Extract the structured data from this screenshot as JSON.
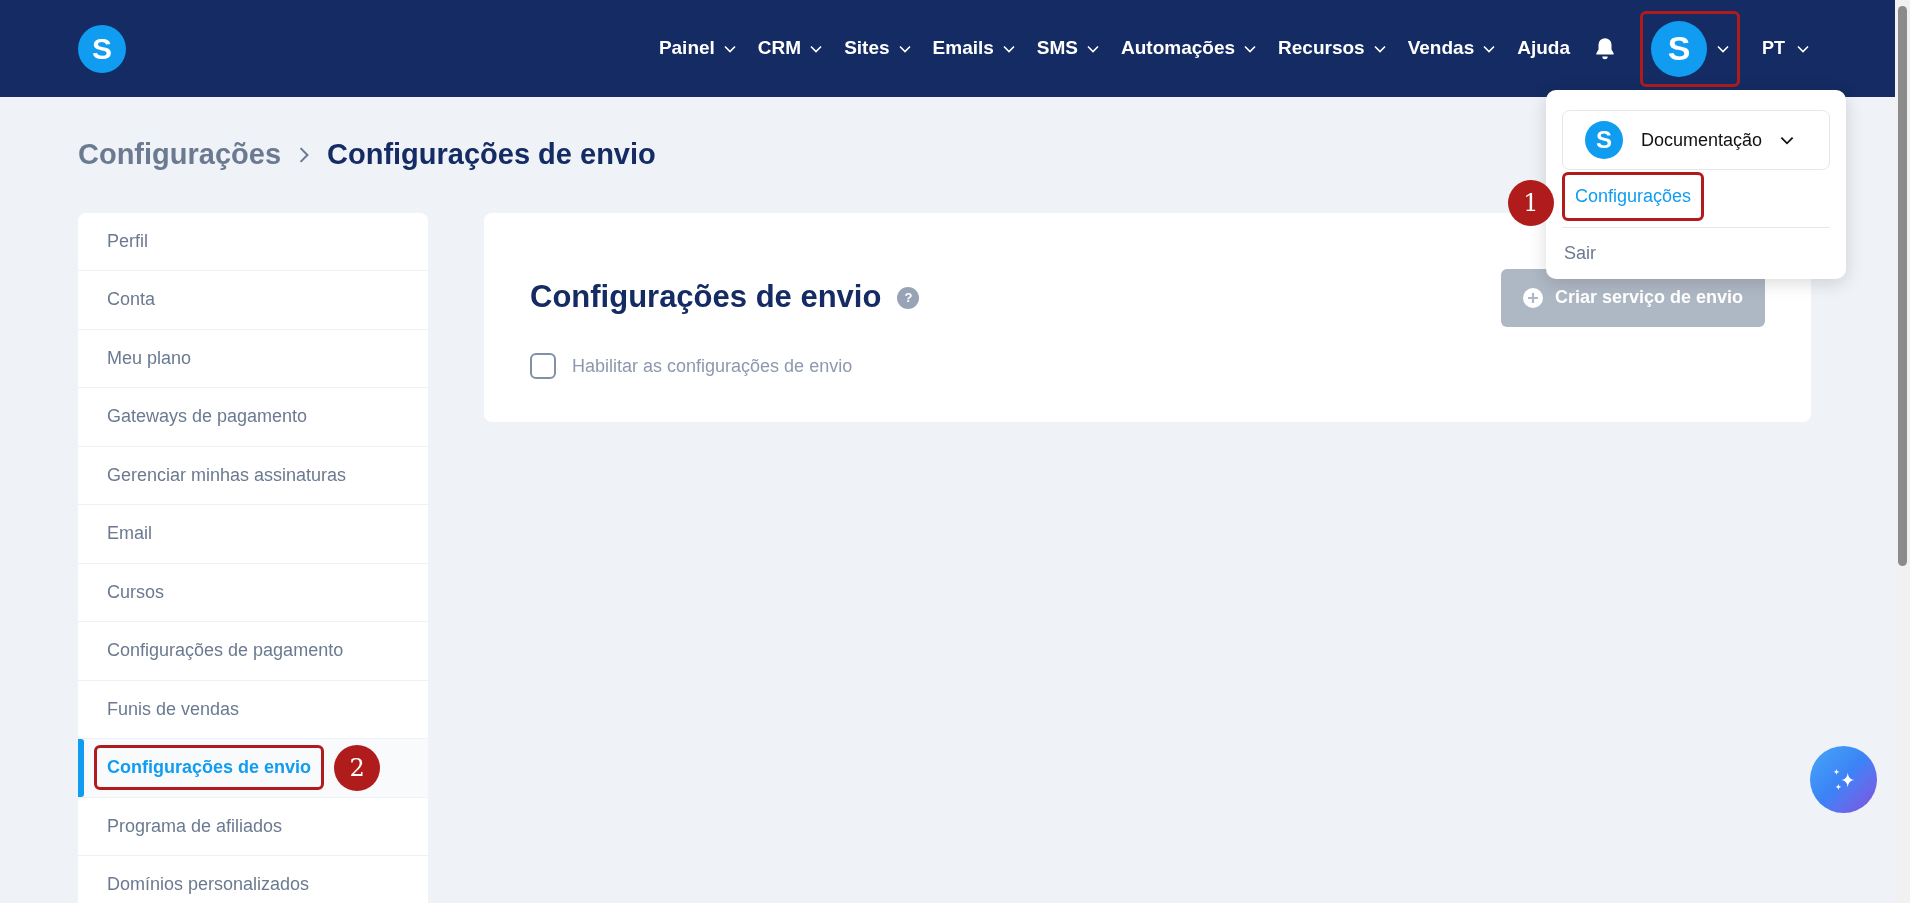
{
  "nav": {
    "logo": "S",
    "items": [
      {
        "label": "Painel",
        "has_menu": true
      },
      {
        "label": "CRM",
        "has_menu": true
      },
      {
        "label": "Sites",
        "has_menu": true
      },
      {
        "label": "Emails",
        "has_menu": true
      },
      {
        "label": "SMS",
        "has_menu": true
      },
      {
        "label": "Automações",
        "has_menu": true
      },
      {
        "label": "Recursos",
        "has_menu": true
      },
      {
        "label": "Vendas",
        "has_menu": true
      },
      {
        "label": "Ajuda",
        "has_menu": false
      }
    ],
    "avatar": "S",
    "avatar_outlined": true,
    "language": "PT"
  },
  "account_menu": {
    "avatar": "S",
    "account": "Documentação",
    "items": [
      {
        "label": "Configurações",
        "highlighted": true,
        "callout": "1"
      },
      {
        "label": "Sair",
        "highlighted": false
      }
    ]
  },
  "breadcrumb": [
    {
      "label": "Configurações",
      "current": false
    },
    {
      "label": "Configurações de envio",
      "current": true
    }
  ],
  "sidebar": {
    "items": [
      {
        "label": "Perfil",
        "selected": false
      },
      {
        "label": "Conta",
        "selected": false
      },
      {
        "label": "Meu plano",
        "selected": false
      },
      {
        "label": "Gateways de pagamento",
        "selected": false
      },
      {
        "label": "Gerenciar minhas assinaturas",
        "selected": false
      },
      {
        "label": "Email",
        "selected": false
      },
      {
        "label": "Cursos",
        "selected": false
      },
      {
        "label": "Configurações de pagamento",
        "selected": false
      },
      {
        "label": "Funis de vendas",
        "selected": false
      },
      {
        "label": "Configurações de envio",
        "selected": true,
        "callout": "2"
      },
      {
        "label": "Programa de afiliados",
        "selected": false
      },
      {
        "label": "Domínios personalizados",
        "selected": false
      }
    ]
  },
  "card": {
    "title": "Configurações de envio",
    "help": "?",
    "checkbox": {
      "label": "Habilitar as configurações de envio",
      "checked": false
    },
    "button": {
      "label": "Criar serviço de envio",
      "disabled": true
    }
  }
}
